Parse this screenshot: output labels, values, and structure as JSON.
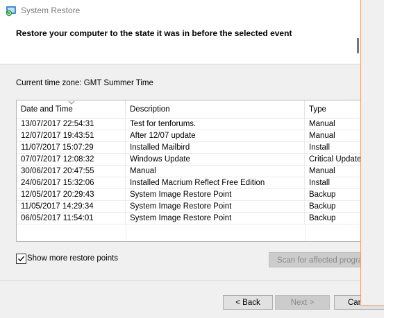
{
  "window": {
    "title": "System Restore"
  },
  "header": {
    "text": "Restore your computer to the state it was in before the selected event"
  },
  "timezone": {
    "label": "Current time zone: GMT Summer Time"
  },
  "table": {
    "columns": [
      "Date and Time",
      "Description",
      "Type"
    ],
    "sorted_column": "Date and Time",
    "rows": [
      [
        "13/07/2017 22:54:31",
        "Test for tenforums.",
        "Manual"
      ],
      [
        "12/07/2017 19:43:51",
        "After 12/07 update",
        "Manual"
      ],
      [
        "11/07/2017 15:07:29",
        "Installed Mailbird",
        "Install"
      ],
      [
        "07/07/2017 12:08:32",
        "Windows Update",
        "Critical Update"
      ],
      [
        "30/06/2017 20:47:55",
        "Manual",
        "Manual"
      ],
      [
        "24/06/2017 15:32:06",
        "Installed Macrium Reflect Free Edition",
        "Install"
      ],
      [
        "12/05/2017 20:29:43",
        "System Image Restore Point",
        "Backup"
      ],
      [
        "11/05/2017 14:29:34",
        "System Image Restore Point",
        "Backup"
      ],
      [
        "06/05/2017 11:54:01",
        "System Image Restore Point",
        "Backup"
      ]
    ]
  },
  "show_more": {
    "label": "Show more restore points",
    "checked": true
  },
  "buttons": {
    "scan": "Scan for affected programs",
    "back": "< Back",
    "next": "Next >",
    "cancel": "Cancel"
  },
  "icons": {
    "app": "system-restore-icon",
    "sort": "sort-descending-icon",
    "check": "checkmark-icon"
  }
}
